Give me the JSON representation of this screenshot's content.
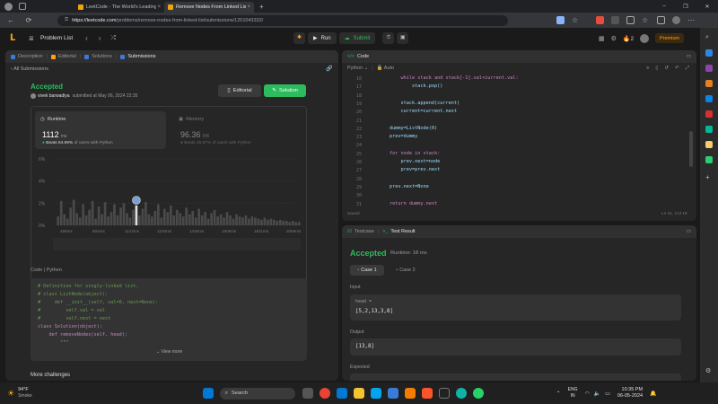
{
  "browser": {
    "tabs": [
      {
        "title": "LeetCode - The World's Leading",
        "active": false,
        "color": "#f0a30a"
      },
      {
        "title": "Remove Nodes From Linked List",
        "active": true,
        "color": "#f0a30a"
      }
    ],
    "new_tab": "+",
    "window_controls": [
      "–",
      "❐",
      "✕"
    ],
    "url_host": "https://leetcode.com",
    "url_path": "/problems/remove-nodes-from-linked-list/submissions/1251043332/"
  },
  "nav": {
    "problem_list": "Problem List",
    "run_label": "Run",
    "submit_label": "Submit",
    "streak": "2",
    "premium": "Premium"
  },
  "left": {
    "tabs": [
      "Description",
      "Editorial",
      "Solutions",
      "Submissions"
    ],
    "back_label": "All Submissions",
    "status": "Accepted",
    "author": "vivek barwadiya",
    "submitted": "submitted at May 06, 2024 22:35",
    "editorial_btn": "Editorial",
    "solution_btn": "Solution",
    "runtime": {
      "label": "Runtime",
      "value": "1112",
      "unit": "ms",
      "beats_prefix": "Beats",
      "beats_pct": "64.99%",
      "beats_suffix": "of users with Python"
    },
    "memory": {
      "label": "Memory",
      "value": "96.36",
      "unit": "MB",
      "beats_prefix": "Beats",
      "beats_pct": "15.87%",
      "beats_suffix": "of users with Python"
    },
    "chart_data": {
      "type": "bar",
      "ylabels": [
        "6%",
        "4%",
        "2%",
        "0%"
      ],
      "xlabels": [
        "486ms",
        "804ms",
        "1122ms",
        "1240ms",
        "1440ms",
        "1606ms",
        "1811ms",
        "2055ms"
      ],
      "values": [
        0.8,
        2.2,
        1.0,
        0.6,
        1.6,
        2.3,
        1.1,
        0.7,
        1.9,
        0.9,
        1.4,
        2.2,
        0.6,
        1.7,
        1.0,
        2.1,
        0.8,
        1.2,
        1.9,
        0.9,
        1.6,
        2.0,
        1.1,
        0.7,
        1.4,
        1.8,
        0.9,
        1.5,
        2.1,
        1.0,
        0.8,
        1.3,
        1.9,
        0.7,
        1.5,
        1.2,
        1.8,
        0.9,
        1.4,
        1.1,
        0.8,
        1.6,
        1.0,
        1.3,
        0.7,
        1.5,
        0.9,
        1.2,
        0.6,
        1.1,
        1.4,
        0.8,
        1.0,
        0.7,
        1.2,
        0.9,
        0.6,
        1.0,
        0.8,
        0.7,
        0.9,
        0.6,
        0.8,
        0.7,
        0.6,
        0.5,
        0.7,
        0.5,
        0.6,
        0.5,
        0.4,
        0.5,
        0.4,
        0.4,
        0.3,
        0.4,
        0.3,
        0.3
      ],
      "highlight_index": 25,
      "ylim": [
        0,
        6
      ]
    },
    "code_header": "Code",
    "code_lang": "Python",
    "code": [
      "# Definition for singly-linked list.",
      "# class ListNode(object):",
      "#     def __init__(self, val=0, next=None):",
      "#         self.val = val",
      "#         self.next = next",
      "class Solution(object):",
      "    def removeNodes(self, head):",
      "        \"\"\""
    ],
    "view_more": "View more",
    "more_challenges": "More challenges"
  },
  "editor": {
    "title": "Code",
    "lang": "Python",
    "mode": "Auto",
    "lines": [
      {
        "n": "16",
        "t": "            while stack and stack[-1].val<current.val:"
      },
      {
        "n": "17",
        "t": "                stack.pop()"
      },
      {
        "n": "18",
        "t": ""
      },
      {
        "n": "19",
        "t": "            stack.append(current)"
      },
      {
        "n": "20",
        "t": "            current=current.next"
      },
      {
        "n": "21",
        "t": ""
      },
      {
        "n": "22",
        "t": "        dummy=ListNode(0)"
      },
      {
        "n": "23",
        "t": "        prev=dummy"
      },
      {
        "n": "24",
        "t": ""
      },
      {
        "n": "25",
        "t": "        for node in stack:"
      },
      {
        "n": "26",
        "t": "            prev.next=node"
      },
      {
        "n": "27",
        "t": "            prev=prev.next"
      },
      {
        "n": "28",
        "t": ""
      },
      {
        "n": "29",
        "t": "        prev.next=None"
      },
      {
        "n": "30",
        "t": ""
      },
      {
        "n": "31",
        "t": "        return dummy.next"
      }
    ],
    "status_left": "Saved",
    "status_right": "Ln 31, Col 19"
  },
  "result": {
    "tab_testcase": "Testcase",
    "tab_result": "Test Result",
    "status": "Accepted",
    "runtime": "Runtime: 18 ms",
    "cases": [
      "Case 1",
      "Case 2"
    ],
    "input_label": "Input",
    "input_var": "head =",
    "input_value": "[5,2,13,3,8]",
    "output_label": "Output",
    "output_value": "[13,8]",
    "expected_label": "Expected"
  },
  "taskbar": {
    "weather_temp": "94°F",
    "weather_desc": "Smoke",
    "search": "Search",
    "lang_top": "ENG",
    "lang_bottom": "IN",
    "time": "10:35 PM",
    "date": "06-05-2024"
  }
}
